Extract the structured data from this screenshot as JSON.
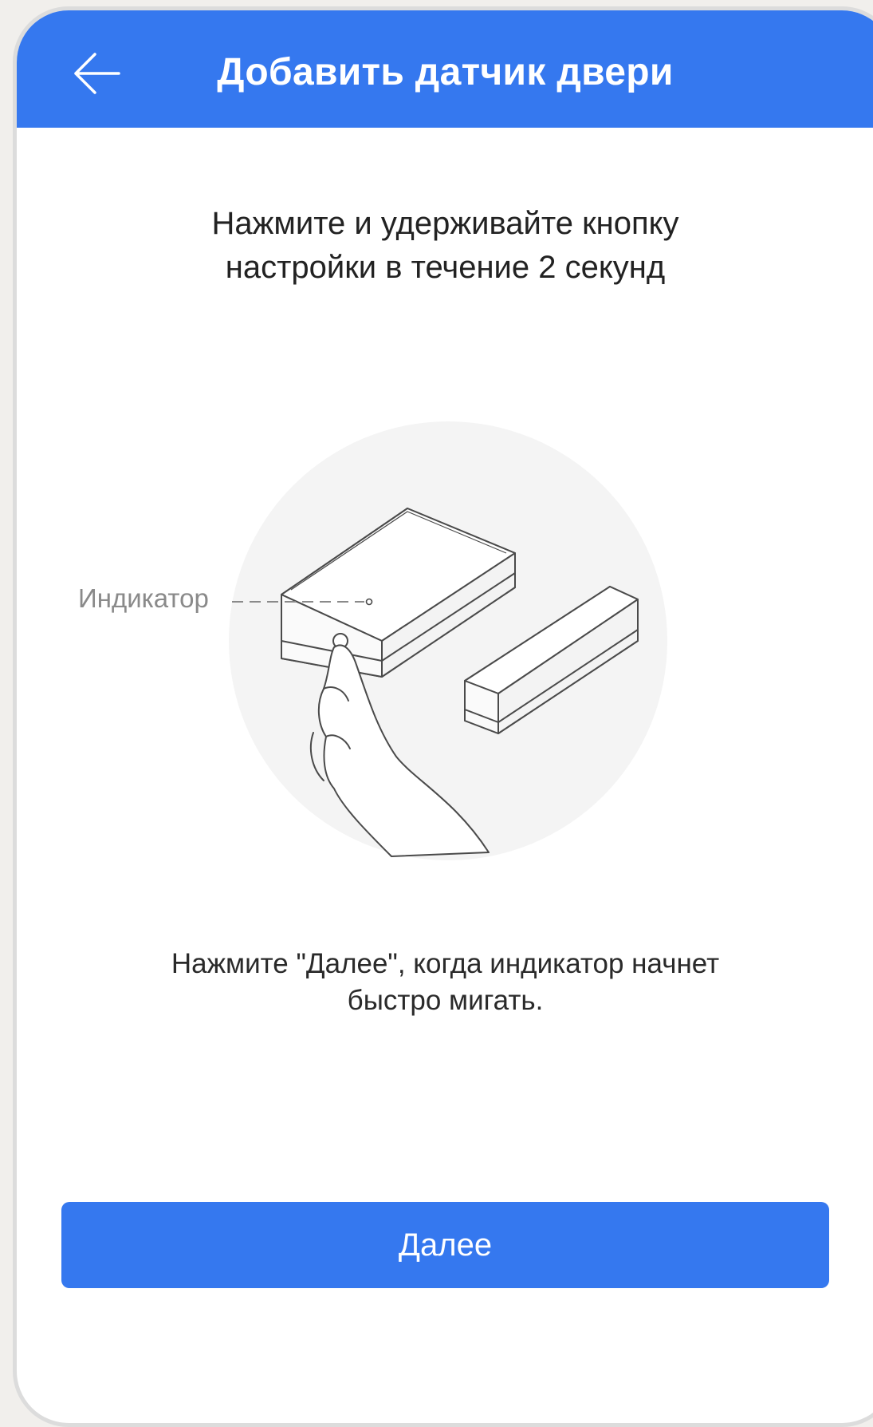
{
  "header": {
    "title": "Добавить датчик двери",
    "back_icon": "arrow-left-icon"
  },
  "instruction": {
    "line1": "Нажмите и удерживайте кнопку",
    "line2": "настройки в течение 2 секунд"
  },
  "illustration": {
    "indicator_label": "Индикатор"
  },
  "hint": {
    "line1": "Нажмите \"Далее\", когда индикатор начнет",
    "line2": "быстро мигать."
  },
  "next_button": {
    "label": "Далее"
  },
  "colors": {
    "accent": "#3578ef",
    "background": "#ffffff",
    "frame": "#f1efec"
  }
}
